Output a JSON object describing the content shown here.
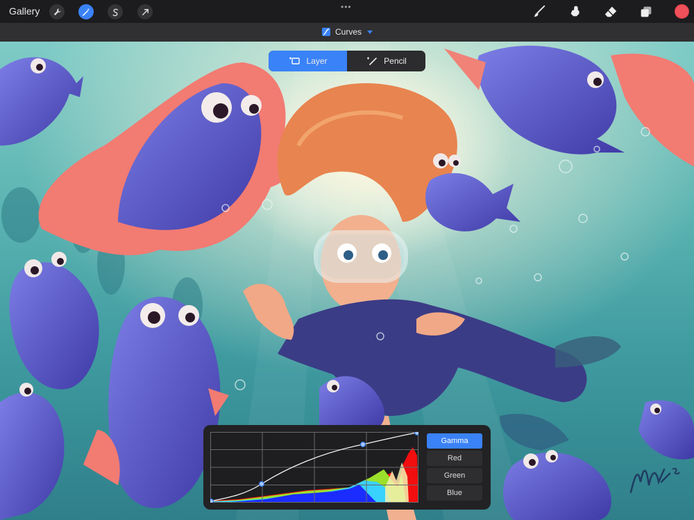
{
  "toolbar": {
    "gallery_label": "Gallery",
    "left_tools": [
      {
        "icon": "wrench-icon",
        "active": false
      },
      {
        "icon": "adjustments-wand-icon",
        "active": true
      },
      {
        "icon": "selection-s-icon",
        "active": false
      },
      {
        "icon": "transform-arrow-icon",
        "active": false
      }
    ],
    "more_label": "•••",
    "right_tools": [
      "brush-icon",
      "smudge-icon",
      "eraser-icon",
      "layers-icon"
    ],
    "current_color": "#f0505a"
  },
  "adjustment": {
    "title": "Curves",
    "icon": "curves-icon"
  },
  "mode_toggle": {
    "layer_label": "Layer",
    "pencil_label": "Pencil",
    "active": "Layer"
  },
  "curves": {
    "channels": [
      "Gamma",
      "Red",
      "Green",
      "Blue"
    ],
    "active_channel": "Gamma"
  },
  "artwork": {
    "signature": "MAK '20"
  },
  "colors": {
    "accent": "#3a82f7",
    "toolbar_bg": "#1c1c1e",
    "panel_bg": "#222224"
  }
}
